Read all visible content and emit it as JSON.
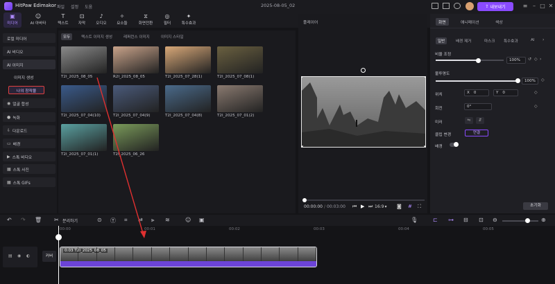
{
  "app": {
    "title": "HitPaw Edimakor",
    "project_date": "2025-08-05_02",
    "export_label": "내보내기"
  },
  "menu": [
    "파일",
    "설정",
    "도움"
  ],
  "toolbar": [
    {
      "icon": "media-icon",
      "label": "미디어",
      "glyph": "▣",
      "active": true
    },
    {
      "icon": "ai-tools-icon",
      "label": "AI 아바타",
      "glyph": "☺"
    },
    {
      "icon": "text-icon",
      "label": "텍스트",
      "glyph": "T"
    },
    {
      "icon": "subtitle-icon",
      "label": "자막",
      "glyph": "⊡"
    },
    {
      "icon": "audio-icon",
      "label": "오디오",
      "glyph": "♪"
    },
    {
      "icon": "elements-icon",
      "label": "요소들",
      "glyph": "✧"
    },
    {
      "icon": "transition-icon",
      "label": "화면전환",
      "glyph": "⧖"
    },
    {
      "icon": "filter-icon",
      "label": "필터",
      "glyph": "◎"
    },
    {
      "icon": "effects-icon",
      "label": "특수효과",
      "glyph": "✦"
    }
  ],
  "sidebar": {
    "items": [
      {
        "label": "로컬 미디어",
        "glyph": ""
      },
      {
        "label": "AI 비디오",
        "glyph": ""
      },
      {
        "label": "AI 이미지",
        "glyph": ""
      },
      {
        "label": "이미지 생성",
        "glyph": ""
      },
      {
        "label": "나의 창작물",
        "glyph": ""
      },
      {
        "label": "얼굴 합성",
        "glyph": "◉"
      },
      {
        "label": "녹화",
        "glyph": "●"
      },
      {
        "label": "다운로드",
        "glyph": "⇩"
      },
      {
        "label": "배경",
        "glyph": "▭"
      },
      {
        "label": "스톡 비디오",
        "glyph": "▶"
      },
      {
        "label": "스톡 사진",
        "glyph": "▦"
      },
      {
        "label": "스톡 GIFs",
        "glyph": "▦"
      }
    ]
  },
  "media": {
    "tabs": [
      "모두",
      "텍스트 이미지 생성",
      "레퍼런스 이미지",
      "이미지 스타일"
    ],
    "items": [
      {
        "label": "T2I_2025_08_05",
        "color": "#8a8a8a"
      },
      {
        "label": "R2I_2025_08_05",
        "color": "#c9a38a"
      },
      {
        "label": "T2I_2025_07_28(1)",
        "color": "#d8a878"
      },
      {
        "label": "T2I_2025_07_08(1)",
        "color": "#6a6040"
      },
      {
        "label": "T2I_2025_07_04(10)",
        "color": "#3a5a8a"
      },
      {
        "label": "T2I_2025_07_04(9)",
        "color": "#4a5a7a"
      },
      {
        "label": "T2I_2025_07_04(8)",
        "color": "#4a6a8a"
      },
      {
        "label": "T2I_2025_07_01(2)",
        "color": "#8a7a70"
      },
      {
        "label": "T2I_2025_07_01(1)",
        "color": "#5aa0a0"
      },
      {
        "label": "T2I_2025_06_26",
        "color": "#7a9a5a"
      }
    ]
  },
  "player": {
    "title": "플레이어",
    "current_time": "00:00:00",
    "total_time": "00:03:00",
    "ratio": "16:9"
  },
  "props": {
    "tabs": [
      "화면",
      "애니메이션",
      "색상"
    ],
    "subtabs": [
      "일반",
      "배경 제거",
      "마스크",
      "특수효과",
      "AI"
    ],
    "ratio_label": "비율 조정",
    "ratio_value": "100%",
    "opacity_label": "불투명도",
    "opacity_value": "100%",
    "position_label": "위치",
    "x_label": "X",
    "x_value": "0",
    "y_label": "Y",
    "y_value": "0",
    "rotate_label": "회전",
    "rotate_value": "0°",
    "mirror_label": "미러",
    "blend_label": "클립 변경",
    "blend_value": "연결",
    "bg_label": "배경",
    "reset_label": "초기화",
    "ratio_level": 0.62,
    "opacity_level": 1.0
  },
  "timeline": {
    "split_label": "분리하기",
    "ruler": [
      "00:00",
      "00:01",
      "00:02",
      "00:03",
      "00:04",
      "00:05"
    ],
    "cover_label": "커버",
    "clip_label": "0:03 T2I_2025_08_05",
    "zoom_level": 0.7
  }
}
